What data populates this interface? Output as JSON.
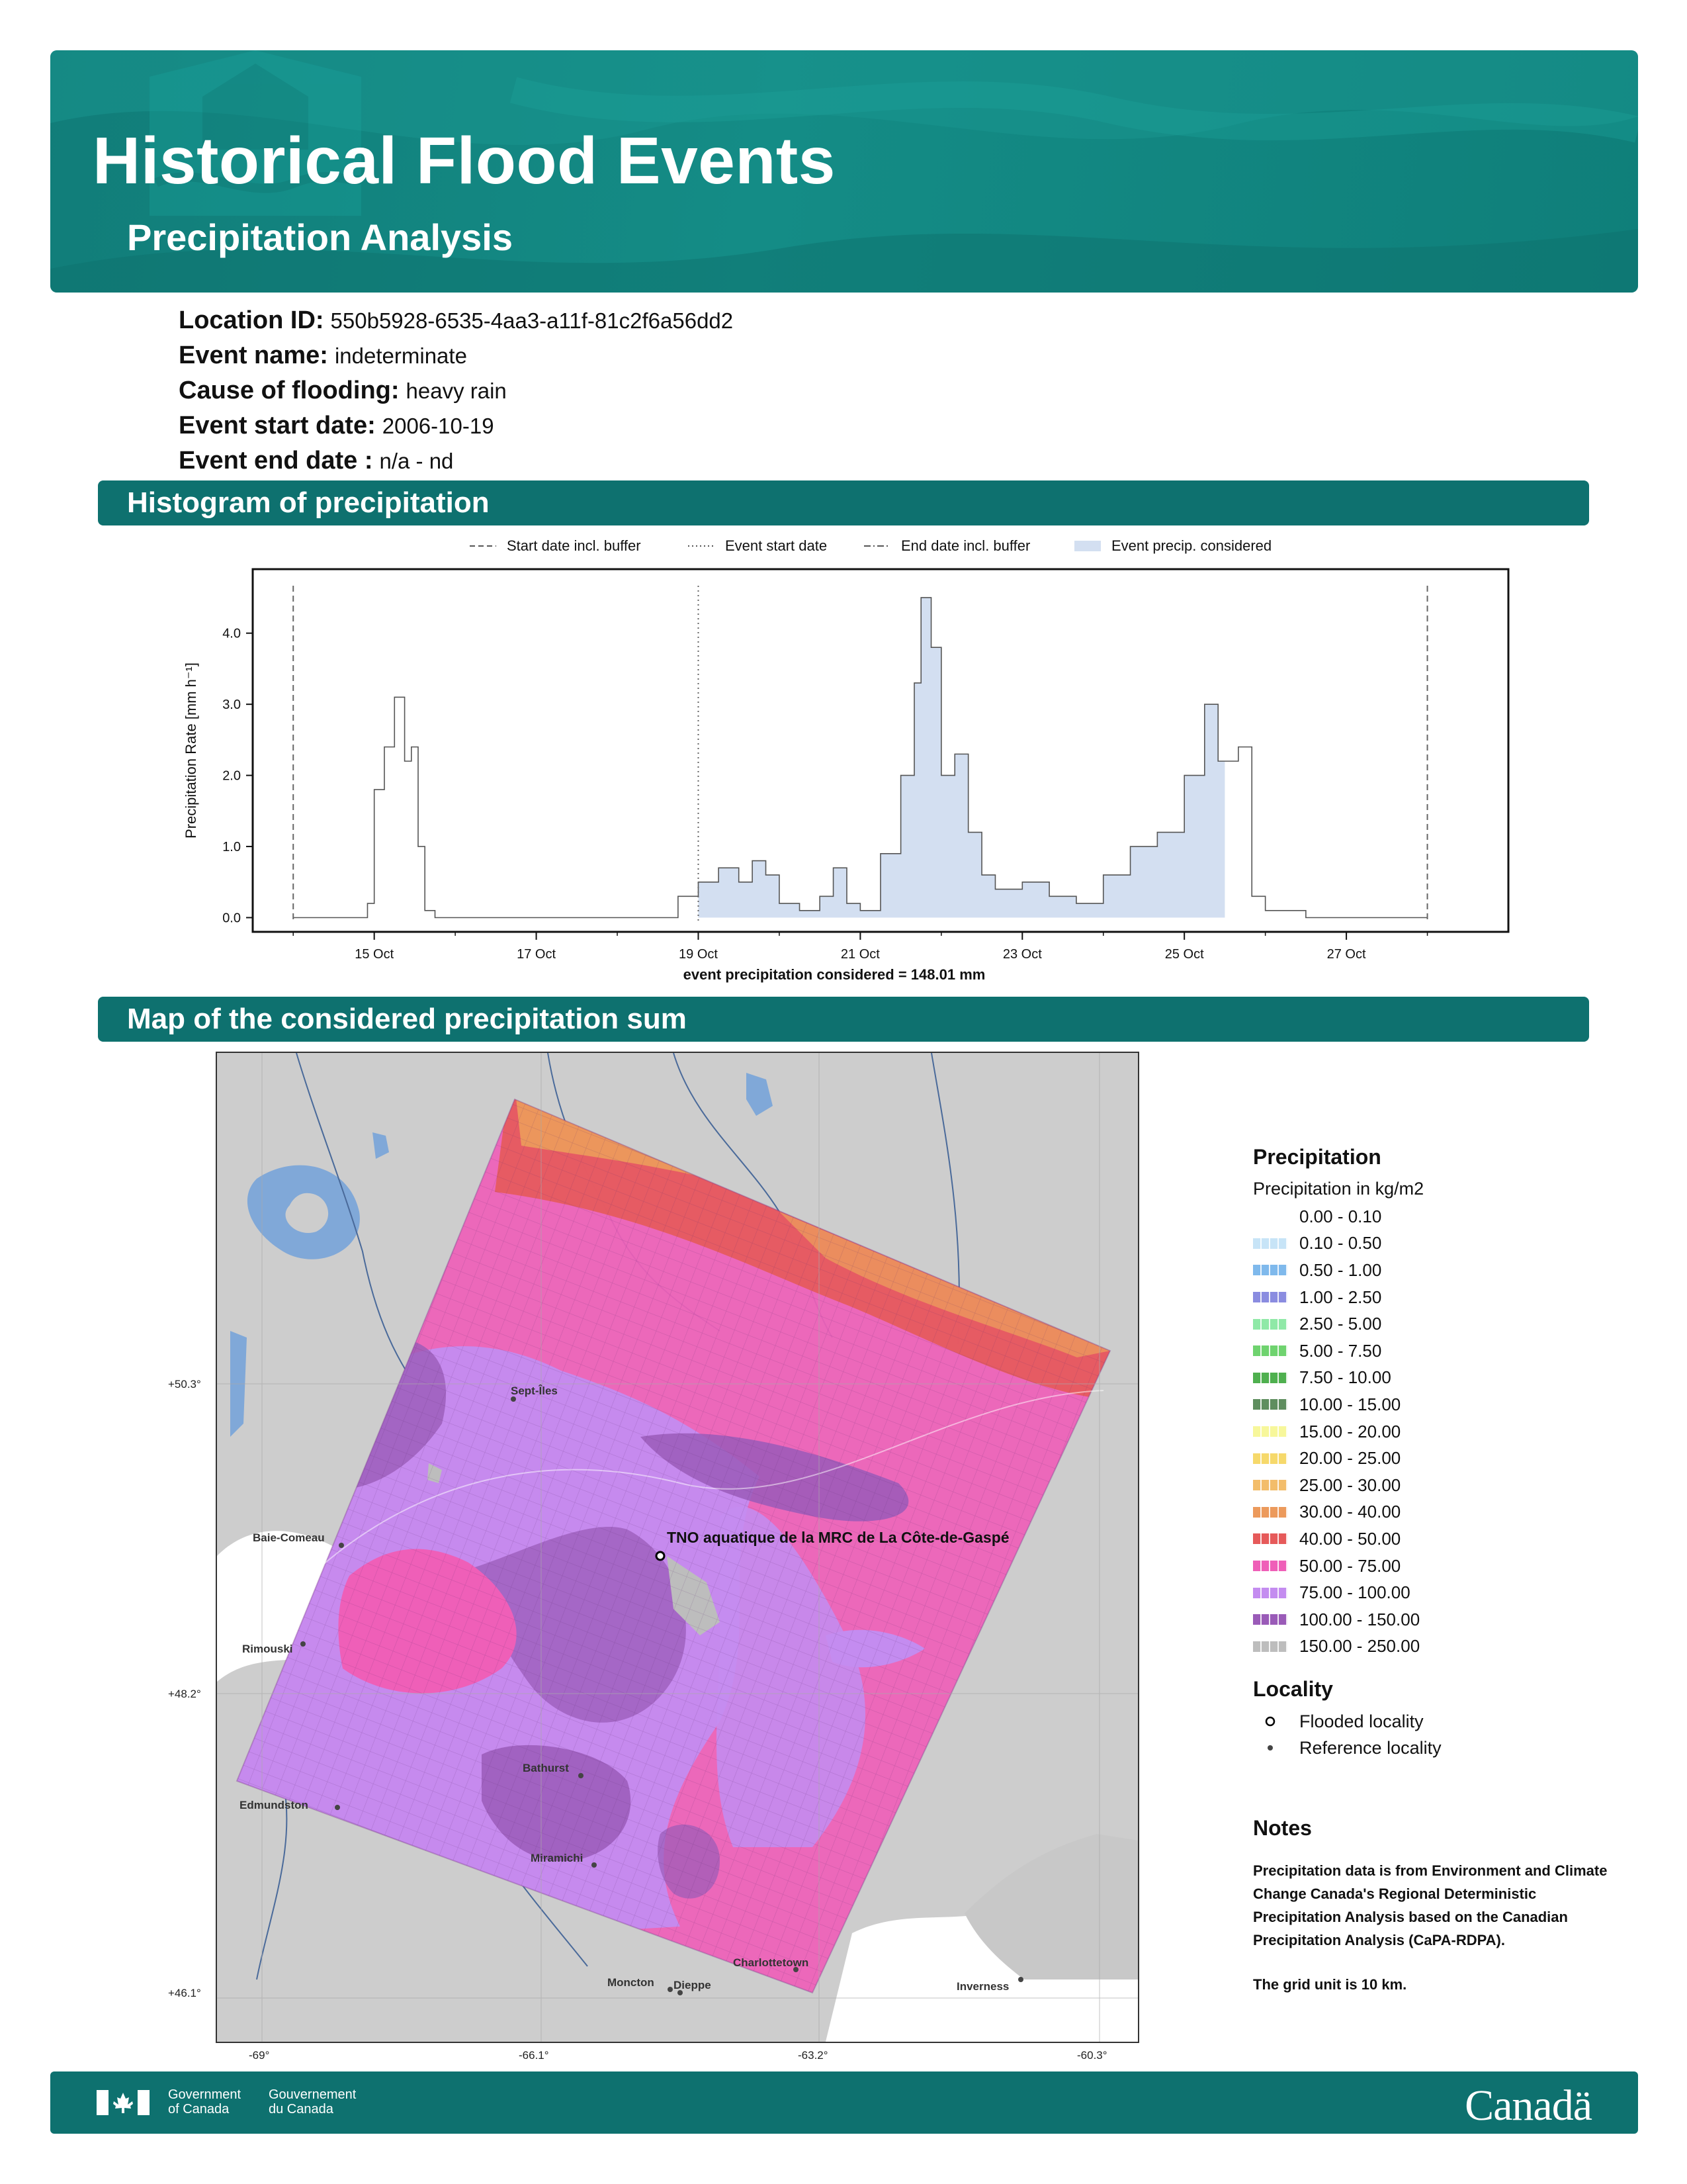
{
  "header": {
    "title": "Historical Flood Events",
    "subtitle": "Precipitation Analysis"
  },
  "meta": [
    {
      "label": "Location ID:",
      "value": "550b5928-6535-4aa3-a11f-81c2f6a56dd2"
    },
    {
      "label": "Event name:",
      "value": "indeterminate"
    },
    {
      "label": "Cause of flooding:",
      "value": "heavy rain"
    },
    {
      "label": "Event start date:",
      "value": "2006-10-19"
    },
    {
      "label": "Event end date :",
      "value": "n/a - nd"
    }
  ],
  "sections": {
    "histogram": "Histogram of precipitation",
    "map": "Map of the considered precipitation sum"
  },
  "chart_data": {
    "type": "area",
    "ylabel": "Precipitation Rate [mm h⁻¹]",
    "xlabel": "event precipitation considered = 148.01 mm",
    "ylim": [
      -0.2,
      4.9
    ],
    "xlim": [
      "2006-10-13 12:00",
      "2006-10-29 00:00"
    ],
    "y_ticks": [
      "0.0",
      "1.0",
      "2.0",
      "3.0",
      "4.0"
    ],
    "x_ticks": [
      "15 Oct",
      "17 Oct",
      "19 Oct",
      "21 Oct",
      "23 Oct",
      "25 Oct",
      "27 Oct"
    ],
    "x_tick_dates": [
      "2006-10-15",
      "2006-10-17",
      "2006-10-19",
      "2006-10-21",
      "2006-10-23",
      "2006-10-25",
      "2006-10-27"
    ],
    "legend_position": "top",
    "legend": [
      {
        "label": "Start date incl. buffer",
        "style": "dashed"
      },
      {
        "label": "Event start date",
        "style": "dotted"
      },
      {
        "label": "End date incl. buffer",
        "style": "dashdot"
      },
      {
        "label": "Event precip. considered",
        "style": "fill",
        "color": "#d3dff1"
      }
    ],
    "reference_lines": [
      {
        "date": "2006-10-14 00:00",
        "style": "dashed"
      },
      {
        "date": "2006-10-19 00:00",
        "style": "dotted"
      },
      {
        "date": "2006-10-28 00:00",
        "style": "dashed"
      }
    ],
    "fill_from": "2006-10-19 00:00",
    "fill_to": "2006-10-25 12:00",
    "series": [
      {
        "points": [
          [
            "2006-10-14 00:00",
            0.0
          ],
          [
            "2006-10-14 20:00",
            0.0
          ],
          [
            "2006-10-14 22:00",
            0.2
          ],
          [
            "2006-10-15 00:00",
            1.8
          ],
          [
            "2006-10-15 03:00",
            2.4
          ],
          [
            "2006-10-15 06:00",
            3.1
          ],
          [
            "2006-10-15 09:00",
            2.2
          ],
          [
            "2006-10-15 11:00",
            2.4
          ],
          [
            "2006-10-15 13:00",
            1.0
          ],
          [
            "2006-10-15 15:00",
            0.1
          ],
          [
            "2006-10-15 18:00",
            0.0
          ],
          [
            "2006-10-18 12:00",
            0.0
          ],
          [
            "2006-10-18 18:00",
            0.3
          ],
          [
            "2006-10-19 00:00",
            0.5
          ],
          [
            "2006-10-19 06:00",
            0.7
          ],
          [
            "2006-10-19 12:00",
            0.5
          ],
          [
            "2006-10-19 16:00",
            0.8
          ],
          [
            "2006-10-19 20:00",
            0.6
          ],
          [
            "2006-10-20 00:00",
            0.2
          ],
          [
            "2006-10-20 06:00",
            0.1
          ],
          [
            "2006-10-20 12:00",
            0.3
          ],
          [
            "2006-10-20 16:00",
            0.7
          ],
          [
            "2006-10-20 20:00",
            0.2
          ],
          [
            "2006-10-21 00:00",
            0.1
          ],
          [
            "2006-10-21 06:00",
            0.9
          ],
          [
            "2006-10-21 12:00",
            2.0
          ],
          [
            "2006-10-21 16:00",
            3.3
          ],
          [
            "2006-10-21 18:00",
            4.5
          ],
          [
            "2006-10-21 21:00",
            3.8
          ],
          [
            "2006-10-22 00:00",
            2.0
          ],
          [
            "2006-10-22 04:00",
            2.3
          ],
          [
            "2006-10-22 08:00",
            1.2
          ],
          [
            "2006-10-22 12:00",
            0.6
          ],
          [
            "2006-10-22 16:00",
            0.4
          ],
          [
            "2006-10-23 00:00",
            0.5
          ],
          [
            "2006-10-23 08:00",
            0.3
          ],
          [
            "2006-10-23 16:00",
            0.2
          ],
          [
            "2006-10-24 00:00",
            0.6
          ],
          [
            "2006-10-24 08:00",
            1.0
          ],
          [
            "2006-10-24 16:00",
            1.2
          ],
          [
            "2006-10-25 00:00",
            2.0
          ],
          [
            "2006-10-25 06:00",
            3.0
          ],
          [
            "2006-10-25 10:00",
            2.2
          ],
          [
            "2006-10-25 16:00",
            2.4
          ],
          [
            "2006-10-25 20:00",
            0.3
          ],
          [
            "2006-10-26 00:00",
            0.1
          ],
          [
            "2006-10-26 12:00",
            0.0
          ],
          [
            "2006-10-28 00:00",
            0.0
          ]
        ]
      }
    ]
  },
  "map": {
    "lat_labels": [
      "+50.3°",
      "+48.2°",
      "+46.1°"
    ],
    "lon_labels": [
      "-69°",
      "-66.1°",
      "-63.2°",
      "-60.3°"
    ],
    "place_labels": [
      "Sept-Îles",
      "Baie-Comeau",
      "Rimouski",
      "Bathurst",
      "Edmundston",
      "Miramichi",
      "Moncton",
      "Dieppe",
      "Charlottetown",
      "Inverness"
    ],
    "flooded_locality": "TNO aquatique de la MRC de La Côte-de-Gaspé"
  },
  "legend": {
    "title": "Precipitation",
    "subtitle": "Precipitation in kg/m2",
    "classes": [
      {
        "range": "0.00 - 0.10",
        "color": "#ffffff"
      },
      {
        "range": "0.10 - 0.50",
        "color": "#c7e4f7"
      },
      {
        "range": "0.50 - 1.00",
        "color": "#7fb9ec"
      },
      {
        "range": "1.00 - 2.50",
        "color": "#8a8ce0"
      },
      {
        "range": "2.50 - 5.00",
        "color": "#8fe9a7"
      },
      {
        "range": "5.00 - 7.50",
        "color": "#6fd36f"
      },
      {
        "range": "7.50 - 10.00",
        "color": "#4fb04f"
      },
      {
        "range": "10.00 - 15.00",
        "color": "#5f8e5f"
      },
      {
        "range": "15.00 - 20.00",
        "color": "#f7f79b"
      },
      {
        "range": "20.00 - 25.00",
        "color": "#f6d96b"
      },
      {
        "range": "25.00 - 30.00",
        "color": "#f3bd6a"
      },
      {
        "range": "30.00 - 40.00",
        "color": "#ec9a5c"
      },
      {
        "range": "40.00 - 50.00",
        "color": "#e65a5a"
      },
      {
        "range": "50.00 - 75.00",
        "color": "#ef5fb8"
      },
      {
        "range": "75.00 - 100.00",
        "color": "#c48cf0"
      },
      {
        "range": "100.00 - 150.00",
        "color": "#9a5bb8"
      },
      {
        "range": "150.00 - 250.00",
        "color": "#bdbdbd"
      }
    ],
    "locality_title": "Locality",
    "flooded_label": "Flooded locality",
    "reference_label": "Reference locality"
  },
  "notes": {
    "title": "Notes",
    "text1": "Precipitation data is from Environment and Climate Change Canada's Regional Deterministic Precipitation Analysis based on the Canadian Precipitation Analysis (CaPA-RDPA).",
    "text2": "The grid unit is 10 km."
  },
  "footer": {
    "gov_en_1": "Government",
    "gov_en_2": "of Canada",
    "gov_fr_1": "Gouvernement",
    "gov_fr_2": "du Canada",
    "wordmark": "Canadä"
  }
}
